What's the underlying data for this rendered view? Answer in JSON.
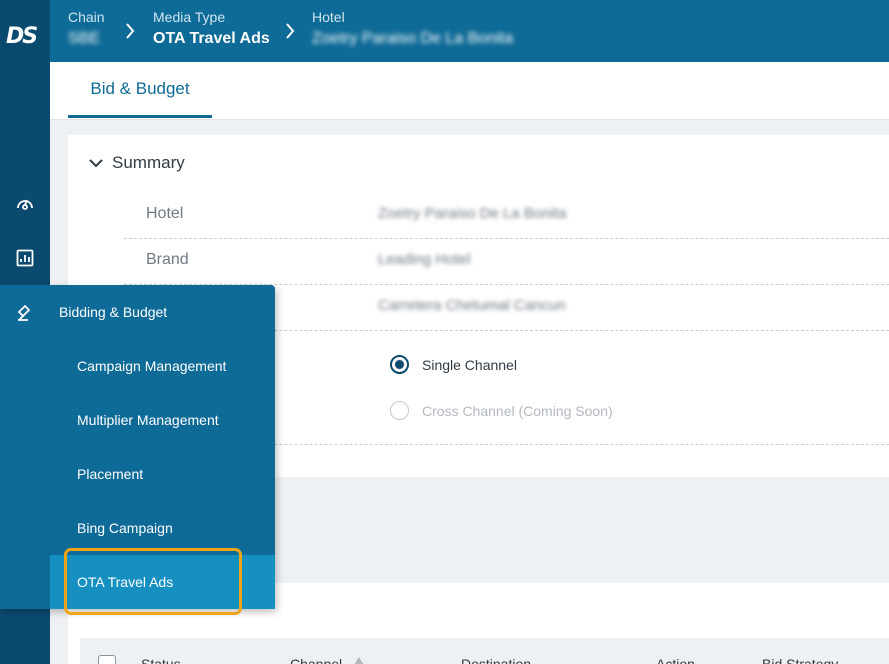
{
  "app": {
    "logo": "DS"
  },
  "breadcrumb": [
    {
      "label": "Chain",
      "value": "SBE"
    },
    {
      "label": "Media Type",
      "value": "OTA Travel Ads"
    },
    {
      "label": "Hotel",
      "value": "Zoetry Paraiso De La Bonita"
    }
  ],
  "tabs": [
    {
      "label": "Bid & Budget",
      "active": true
    }
  ],
  "summary": {
    "title": "Summary",
    "rows": [
      {
        "key": "Hotel",
        "value": "Zoetry Paraiso De La Bonita"
      },
      {
        "key": "Brand",
        "value": "Leading Hotel"
      },
      {
        "key": "",
        "value": "Carretera Chetumal Cancun"
      }
    ],
    "channel_options": [
      {
        "label": "Single Channel",
        "selected": true,
        "disabled": false
      },
      {
        "label": "Cross Channel (Coming Soon)",
        "selected": false,
        "disabled": true
      }
    ]
  },
  "table": {
    "columns": [
      "Status",
      "Channel",
      "Destination",
      "Action",
      "Bid Strategy"
    ]
  },
  "flyout": {
    "title": "Bidding & Budget",
    "items": [
      {
        "label": "Campaign Management"
      },
      {
        "label": "Multiplier Management"
      },
      {
        "label": "Placement"
      },
      {
        "label": "Bing Campaign"
      },
      {
        "label": "OTA Travel Ads",
        "selected": true
      }
    ]
  },
  "rail_icons": [
    "dashboard-icon",
    "report-icon",
    "bidding-icon",
    "hotel-icon",
    "activity-icon",
    "user-icon",
    "settings-icon"
  ],
  "colors": {
    "rail": "#0b4a6f",
    "header": "#0e6a96",
    "selected": "#1690c0",
    "highlight": "#f0a518"
  }
}
